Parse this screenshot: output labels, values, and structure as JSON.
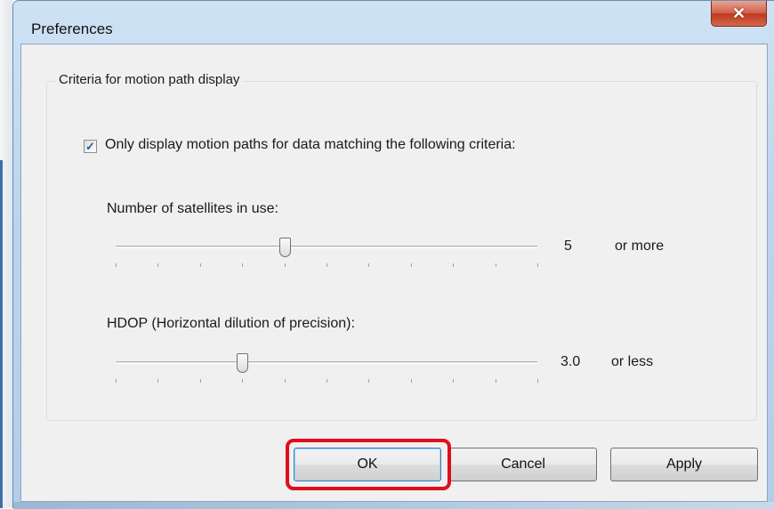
{
  "window": {
    "title": "Preferences",
    "close_glyph": "✕",
    "close_icon": "close-icon"
  },
  "group": {
    "legend": "Criteria for motion path display"
  },
  "filter": {
    "checked": true,
    "check_glyph": "✓",
    "label": "Only display motion paths for data matching the following criteria:"
  },
  "satellites": {
    "caption": "Number of satellites in use:",
    "value": "5",
    "qualifier": "or more",
    "level": 0.4,
    "tick_count": 11
  },
  "hdop": {
    "caption": "HDOP (Horizontal dilution of precision):",
    "value": "3.0",
    "qualifier": "or less",
    "level": 0.3,
    "tick_count": 11
  },
  "buttons": {
    "ok": "OK",
    "cancel": "Cancel",
    "apply": "Apply"
  },
  "colors": {
    "highlight": "#e0101b",
    "close_button": "#c0391f",
    "dialog_background": "#f0f0f0"
  }
}
